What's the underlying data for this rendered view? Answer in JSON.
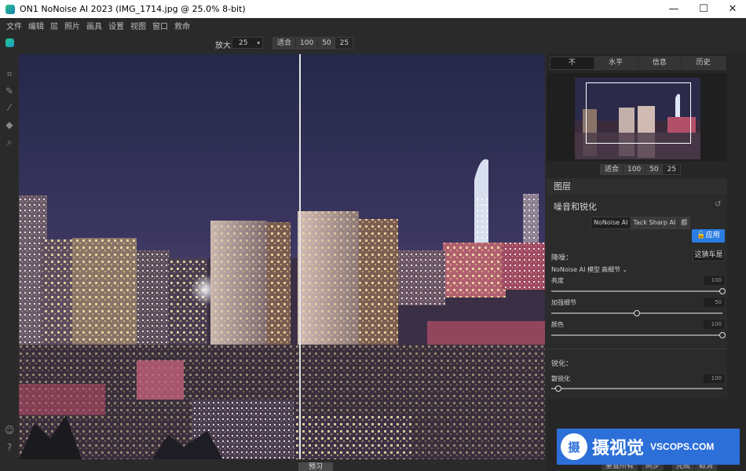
{
  "window": {
    "title": "ON1 NoNoise AI 2023 (IMG_1714.jpg @ 25.0% 8-bit)",
    "controls": {
      "minimize": "—",
      "maximize": "☐",
      "close": "✕"
    }
  },
  "menu": [
    "文件",
    "编辑",
    "层",
    "照片",
    "画具",
    "设置",
    "视图",
    "窗口",
    "救命"
  ],
  "toolbar": {
    "zoom_label": "放大",
    "zoom_value": "25",
    "zoom_buttons": [
      "适合",
      "100",
      "50",
      "25"
    ]
  },
  "left_tools": [
    "crop-icon",
    "brush-icon",
    "eyedropper-icon",
    "eraser-icon",
    "zoom-icon",
    "user-icon",
    "help-icon"
  ],
  "bottom": {
    "preview_label": "预习"
  },
  "right_panel": {
    "tabs": [
      "不",
      "水平",
      "信息",
      "历史"
    ],
    "nav_zoom": [
      "适合",
      "100",
      "50",
      "25"
    ],
    "layers_title": "图层",
    "section_title": "噪音和锐化",
    "modes": [
      "NoNoise AI",
      "Tack Sharp AI",
      "都"
    ],
    "apply_label": "应用",
    "reset_label": "这猜车是",
    "denoise_heading": "降噪：",
    "model_label": "NoNoise AI 模型",
    "model_value": "高细节",
    "sliders": [
      {
        "label": "亮度",
        "value": "100",
        "level": 100
      },
      {
        "label": "加强细节",
        "value": "50",
        "level": 50
      },
      {
        "label": "颜色",
        "value": "100",
        "level": 100
      }
    ],
    "sharpen_heading": "锐化：",
    "sharpen_slider": {
      "label": "散锐化",
      "value": "100",
      "level": 4
    }
  },
  "footer_buttons": [
    "重置所有",
    "同步",
    "完成",
    "取消"
  ],
  "watermark": {
    "logo": "摄",
    "text": "摄视觉",
    "url": "VSCOPS.COM"
  }
}
